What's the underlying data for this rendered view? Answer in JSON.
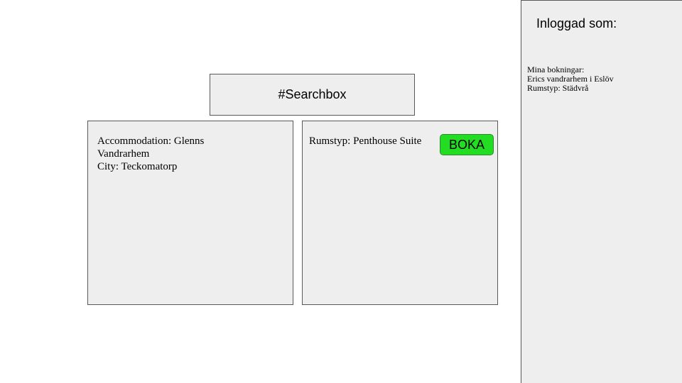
{
  "search": {
    "label": "#Searchbox"
  },
  "accommodation_card": {
    "accommodation_line1": "Accommodation: Glenns",
    "accommodation_line2": "Vandrarhem",
    "city_line": "City: Teckomatorp"
  },
  "room_card": {
    "room_type": "Rumstyp: Penthouse Suite",
    "book_label": "BOKA",
    "book_color": "#22dd22"
  },
  "sidebar": {
    "logged_in_label": "Inloggad som:",
    "bookings_heading": "Mina bokningar:",
    "booking_name": "Erics vandrarhem i Eslöv",
    "booking_room_type": "Rumstyp: Städvrå"
  }
}
